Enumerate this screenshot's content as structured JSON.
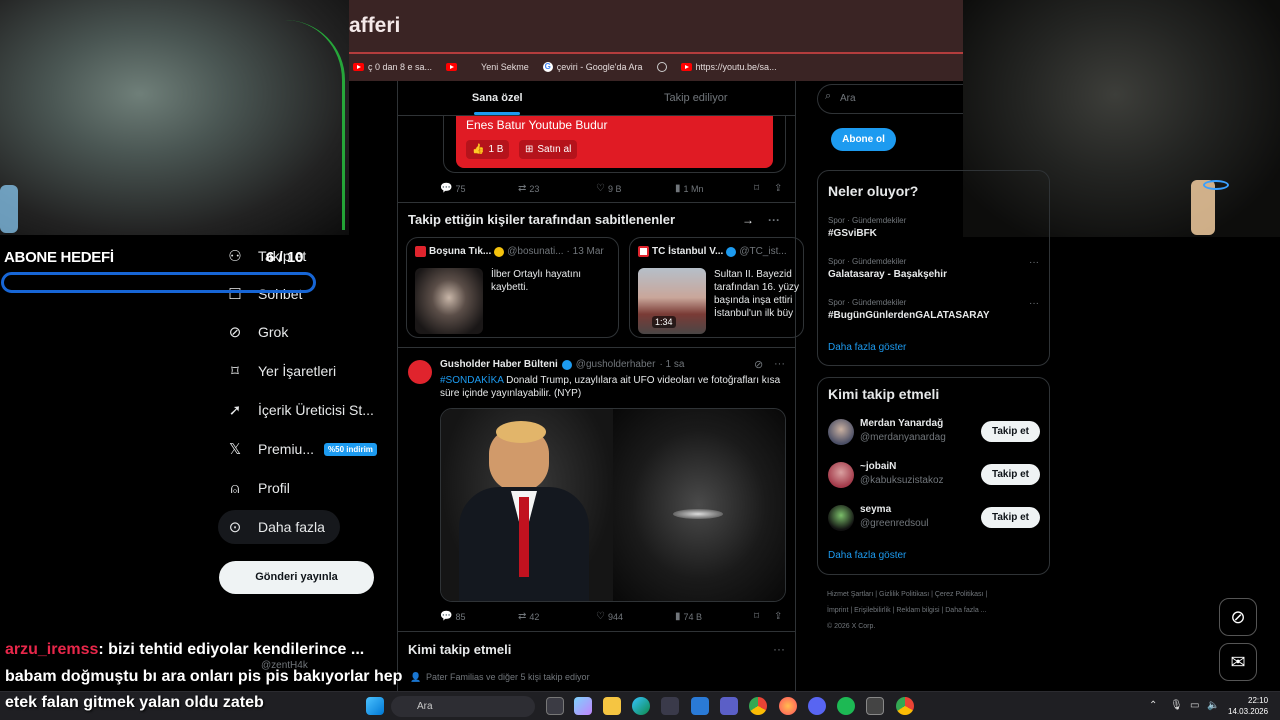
{
  "browser": {
    "title": "afferi",
    "bookmarks": [
      {
        "icon": "youtube-icon",
        "label": "ç 0 dan 8 e sa..."
      },
      {
        "icon": "youtube-icon",
        "label": ""
      },
      {
        "icon": "none",
        "label": "Yeni Sekme"
      },
      {
        "icon": "google-icon",
        "label": "çeviri - Google'da Ara"
      },
      {
        "icon": "globe-icon",
        "label": ""
      },
      {
        "icon": "youtube-icon",
        "label": "https://youtu.be/sa..."
      }
    ]
  },
  "overlay": {
    "goal_label": "ABONE HEDEFİ",
    "goal_count": "6 / 10",
    "goal_progress": 0.6,
    "chat": [
      {
        "user": "arzu_iremss",
        "text": ": bizi tehtid ediyolar kendilerince ..."
      },
      {
        "user": "",
        "text": "babam doğmuştu bı ara onları pis pis bakıyorlar hep"
      },
      {
        "user": "",
        "text": "etek falan gitmek yalan oldu zateb"
      }
    ]
  },
  "nav": {
    "items": [
      {
        "icon": "add-person-icon",
        "label": "Takip et"
      },
      {
        "icon": "chat-icon",
        "label": "Sohbet"
      },
      {
        "icon": "grok-icon",
        "label": "Grok"
      },
      {
        "icon": "bookmark-icon",
        "label": "Yer İşaretleri"
      },
      {
        "icon": "rocket-icon",
        "label": "İçerik Üreticisi St..."
      },
      {
        "icon": "x-logo-icon",
        "label": "Premiu..."
      },
      {
        "icon": "profile-icon",
        "label": "Profil"
      },
      {
        "icon": "more-icon",
        "label": "Daha fazla"
      }
    ],
    "premium_badge": "%50 indirim",
    "post_button": "Gönderi yayınla",
    "account_handle": "@zentH4k"
  },
  "timeline": {
    "tabs": [
      "Sana özel",
      "Takip ediliyor"
    ],
    "active_tab": 0,
    "promo": {
      "text": "Enes Batur Youtube Budur",
      "like_label": "1 B",
      "buy_label": "Satın al"
    },
    "promo_actions": {
      "replies": "75",
      "reposts": "23",
      "likes": "9 B",
      "views": "1 Mn"
    },
    "pinned_header": "Takip ettiğin kişiler tarafından sabitlenenler",
    "pinned": [
      {
        "name": "Boşuna Tık...",
        "handle": "@bosunati...",
        "date": "· 13 Mar",
        "text": "İlber Ortaylı hayatını kaybetti.",
        "video_time": ""
      },
      {
        "name": "TC İstanbul V...",
        "handle": "@TC_ist...",
        "date": "",
        "text": "Sultan II. Bayezid tarafından 16. yüzy başında inşa ettiri İstanbul'un ilk büy selatin külliyelerin",
        "video_time": "1:34"
      }
    ],
    "tweet": {
      "name": "Gusholder Haber Bülteni",
      "handle": "@gusholderhaber",
      "time": "· 1 sa",
      "hashtag": "#SONDAKİKA",
      "text": " Donald Trump, uzaylılara ait UFO videoları ve fotoğrafları kısa süre içinde yayınlayabilir. (NYP)",
      "actions": {
        "replies": "85",
        "reposts": "42",
        "likes": "944",
        "views": "74 B"
      }
    },
    "who_to_follow": "Kimi takip etmeli",
    "who_sub": "Pater Familias ve diğer 5 kişi takip ediyor"
  },
  "sidebar": {
    "search_placeholder": "Ara",
    "subscribe_button": "Abone ol",
    "trends_title": "Neler oluyor?",
    "trends": [
      {
        "category": "Spor · Gündemdekiler",
        "name": "#GSviBFK"
      },
      {
        "category": "Spor · Gündemdekiler",
        "name": "Galatasaray - Başakşehir"
      },
      {
        "category": "Spor · Gündemdekiler",
        "name": "#BugünGünlerdenGALATASARAY"
      }
    ],
    "show_more": "Daha fazla göster",
    "follow_title": "Kimi takip etmeli",
    "suggestions": [
      {
        "name": "Merdan Yanardağ",
        "handle": "@merdanyanardag",
        "button": "Takip et"
      },
      {
        "name": "~jobaiN",
        "handle": "@kabuksuzistakoz",
        "button": "Takip et"
      },
      {
        "name": "seyma",
        "handle": "@greenredsoul",
        "button": "Takip et"
      }
    ],
    "show_more_2": "Daha fazla göster",
    "footer": {
      "line1": "Hizmet Şartları  |  Gizlilik Politikası  |  Çerez Politikası  |",
      "line2": "İmprint  |  Erişilebilirlik  |  Reklam bilgisi  |  Daha fazla ...",
      "line3": "© 2026 X Corp."
    }
  },
  "taskbar": {
    "search_placeholder": "Ara",
    "time": "22:10",
    "date": "14.03.2026"
  }
}
